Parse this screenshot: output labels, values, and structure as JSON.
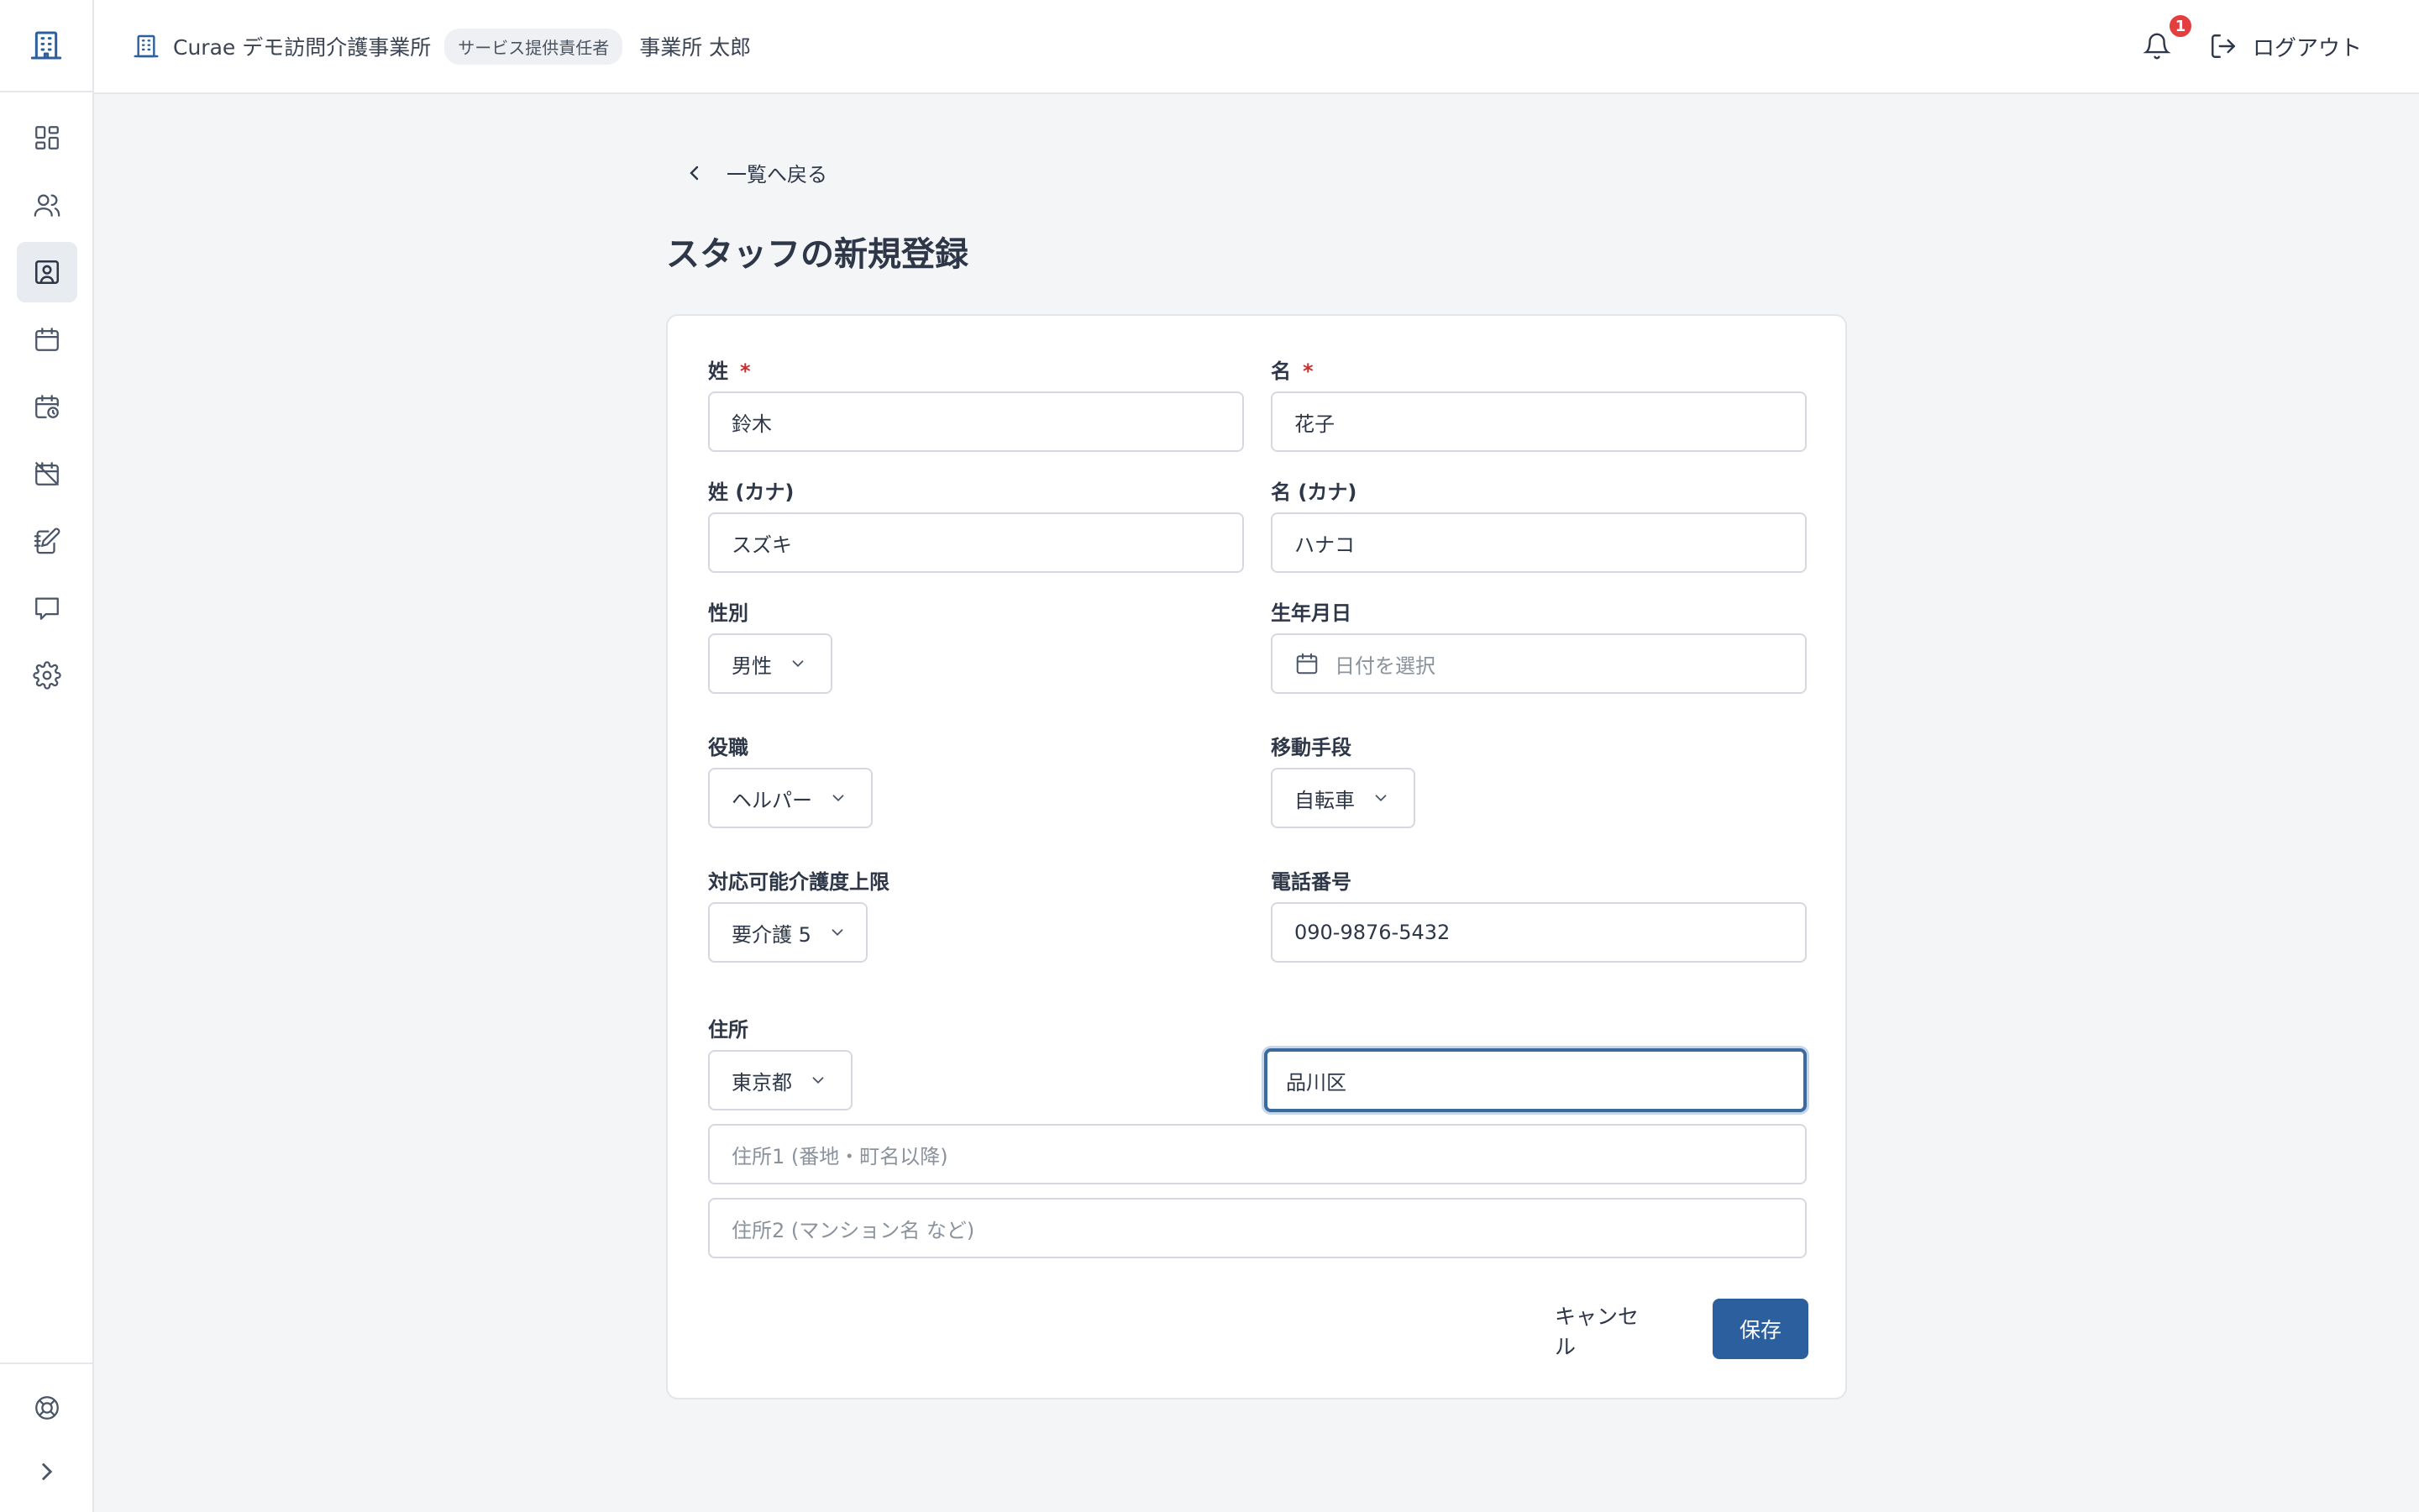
{
  "header": {
    "org_name": "Curae デモ訪問介護事業所",
    "role_badge": "サービス提供責任者",
    "user_name": "事業所 太郎",
    "notification_count": "1",
    "logout_label": "ログアウト"
  },
  "sidebar": {
    "items": [
      {
        "icon": "dashboard-icon"
      },
      {
        "icon": "users-icon"
      },
      {
        "icon": "staff-icon",
        "active": true
      },
      {
        "icon": "calendar-icon"
      },
      {
        "icon": "schedule-icon"
      },
      {
        "icon": "calendar-off-icon"
      },
      {
        "icon": "notebook-icon"
      },
      {
        "icon": "message-icon"
      },
      {
        "icon": "gear-icon"
      }
    ],
    "bottom": [
      {
        "icon": "help-icon"
      },
      {
        "icon": "expand-icon"
      }
    ]
  },
  "page": {
    "back_label": "一覧へ戻る",
    "title": "スタッフの新規登録"
  },
  "form": {
    "last_name": {
      "label": "姓",
      "required_mark": "*",
      "value": "鈴木"
    },
    "first_name": {
      "label": "名",
      "required_mark": "*",
      "value": "花子"
    },
    "last_name_kana": {
      "label": "姓 (カナ)",
      "value": "スズキ"
    },
    "first_name_kana": {
      "label": "名 (カナ)",
      "value": "ハナコ"
    },
    "gender": {
      "label": "性別",
      "value": "男性"
    },
    "birthdate": {
      "label": "生年月日",
      "placeholder": "日付を選択"
    },
    "position": {
      "label": "役職",
      "value": "ヘルパー"
    },
    "transport": {
      "label": "移動手段",
      "value": "自転車"
    },
    "care_level": {
      "label": "対応可能介護度上限",
      "value": "要介護 5"
    },
    "phone": {
      "label": "電話番号",
      "value": "090-9876-5432"
    },
    "address": {
      "label": "住所",
      "prefecture": "東京都",
      "city": "品川区",
      "line1_placeholder": "住所1 (番地・町名以降)",
      "line2_placeholder": "住所2 (マンション名 など)"
    }
  },
  "actions": {
    "cancel_label": "キャンセル",
    "save_label": "保存"
  },
  "colors": {
    "accent": "#2c5f9e",
    "badge": "#e53e3e"
  }
}
